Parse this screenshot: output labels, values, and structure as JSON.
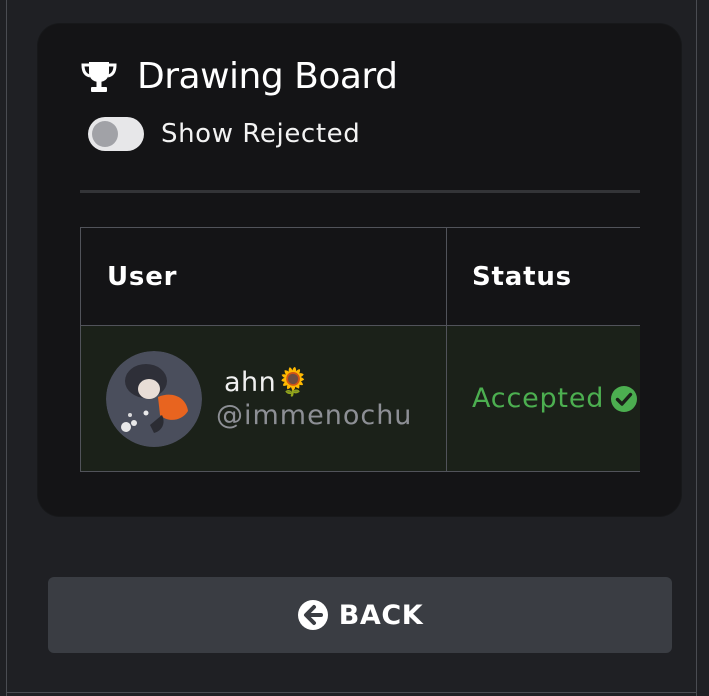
{
  "board": {
    "title": "Drawing Board",
    "show_rejected_label": "Show Rejected",
    "show_rejected_enabled": false
  },
  "table": {
    "columns": [
      "User",
      "Status"
    ],
    "rows": [
      {
        "display_name": "ahn🌻",
        "handle": "@immenochu",
        "status": "Accepted"
      }
    ]
  },
  "back_button": {
    "label": "BACK"
  },
  "icons": {
    "title": "trophy-icon",
    "status": "check-circle-icon",
    "back": "arrow-left-circle-icon"
  },
  "colors": {
    "background": "#1f2024",
    "card": "#141416",
    "accepted": "#4caf50",
    "row_highlight": "#1b2119",
    "button": "#3a3d43"
  }
}
